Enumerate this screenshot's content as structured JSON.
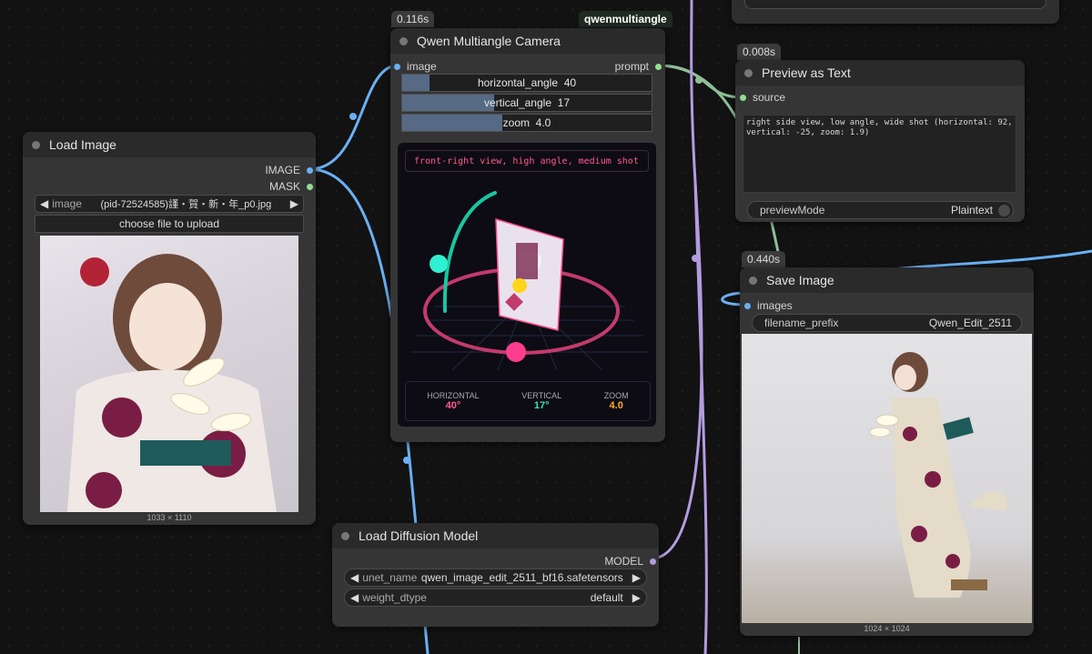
{
  "canvas": {
    "top_badge": "qwenmultiangle"
  },
  "camera_node": {
    "timing": "0.116s",
    "title": "Qwen Multiangle Camera",
    "input_label": "image",
    "output_label": "prompt",
    "sliders": [
      {
        "name": "horizontal_angle",
        "value": "40",
        "fill": 0.11
      },
      {
        "name": "vertical_angle",
        "value": "17",
        "fill": 0.37
      },
      {
        "name": "zoom",
        "value": "4.0",
        "fill": 0.4
      }
    ],
    "preview_prompt": "front-right view, high angle, medium shot",
    "stats": [
      {
        "label": "HORIZONTAL",
        "value": "40°",
        "color": "#ff5c8a"
      },
      {
        "label": "VERTICAL",
        "value": "17°",
        "color": "#35e3b5"
      },
      {
        "label": "ZOOM",
        "value": "4.0",
        "color": "#ffb020"
      }
    ]
  },
  "load_image": {
    "title": "Load Image",
    "outputs": [
      "IMAGE",
      "MASK"
    ],
    "image_label": "image",
    "image_value": "(pid-72524585)謹・賀・新・年_p0.jpg",
    "upload_label": "choose file to upload",
    "dimensions": "1033 × 1110"
  },
  "preview_text": {
    "timing": "0.008s",
    "title": "Preview as Text",
    "input_label": "source",
    "text": "right side view, low angle, wide shot (horizontal: 92, vertical: -25, zoom: 1.9)",
    "mode_label": "previewMode",
    "mode_value": "Plaintext"
  },
  "save_image": {
    "timing": "0.440s",
    "title": "Save Image",
    "input_label": "images",
    "prefix_label": "filename_prefix",
    "prefix_value": "Qwen_Edit_2511",
    "dimensions": "1024 × 1024"
  },
  "load_diffusion": {
    "title": "Load Diffusion Model",
    "output_label": "MODEL",
    "unet_label": "unet_name",
    "unet_value": "qwen_image_edit_2511_bf16.safetensors",
    "dtype_label": "weight_dtype",
    "dtype_value": "default"
  },
  "colors": {
    "image_wire": "#6ab0f3",
    "string_wire": "#8fbf98",
    "model_wire": "#b49be0",
    "accent_pink": "#ff5c8a",
    "accent_teal": "#35e3b5",
    "accent_yellow": "#ffb020"
  }
}
